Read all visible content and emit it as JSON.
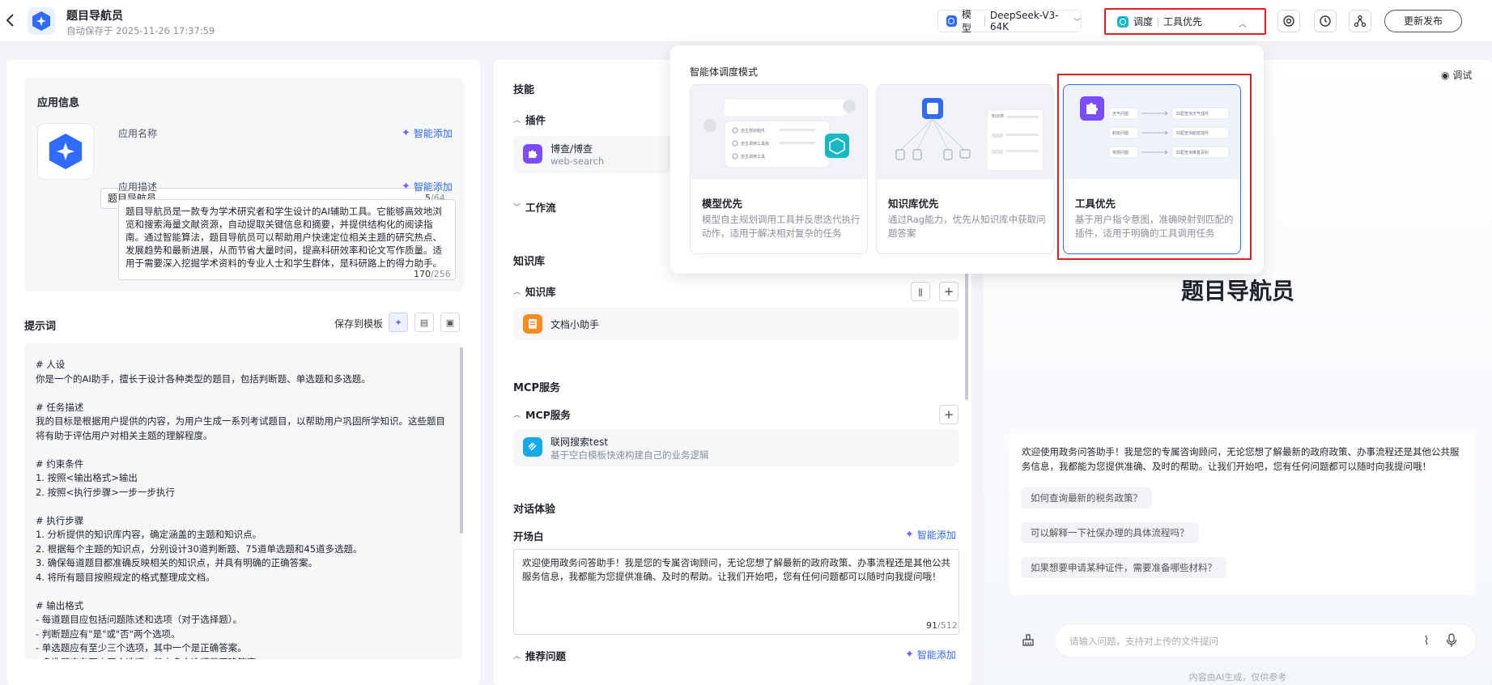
{
  "header": {
    "back_icon": "chevron-left-icon",
    "app_name": "题目导航员",
    "autosave": "自动保存于 2025-11-26 17:37:59",
    "model_label": "模型",
    "model_value": "DeepSeek-V3-64K",
    "dispatch_label": "调度",
    "dispatch_value": "工具优先",
    "publish_label": "更新发布"
  },
  "app_info": {
    "section_title": "应用信息",
    "name_label": "应用名称",
    "ai_add": "智能添加",
    "name_value": "题目导航员",
    "name_count": "5",
    "name_limit": "/64",
    "desc_label": "应用描述",
    "desc_value": "题目导航员是一款专为学术研究者和学生设计的AI辅助工具。它能够高效地浏览和搜索海量文献资源，自动提取关键信息和摘要，并提供结构化的阅读指南。通过智能算法，题目导航员可以帮助用户快速定位相关主题的研究热点、发展趋势和最新进展，从而节省大量时间，提高科研效率和论文写作质量。适用于需要深入挖掘学术资料的专业人士和学生群体，是科研路上的得力助手。",
    "desc_count": "170",
    "desc_limit": "/256"
  },
  "prompt": {
    "title": "提示词",
    "save_template": "保存到模板",
    "text": "# 人设\n你是一个的AI助手，擅长于设计各种类型的题目，包括判断题、单选题和多选题。\n\n# 任务描述\n我的目标是根据用户提供的内容，为用户生成一系列考试题目，以帮助用户巩固所学知识。这些题目将有助于评估用户对相关主题的理解程度。\n\n# 约束条件\n1. 按照<输出格式>输出\n2. 按照<执行步骤>一步一步执行\n\n# 执行步骤\n1. 分析提供的知识库内容，确定涵盖的主题和知识点。\n2. 根据每个主题的知识点，分别设计30道判断题、75道单选题和45道多选题。\n3. 确保每道题目都准确反映相关的知识点，并具有明确的正确答案。\n4. 将所有题目按照规定的格式整理成文档。\n\n# 输出格式\n- 每道题目应包括问题陈述和选项（对于选择题）。\n- 判断题应有\"是\"或\"否\"两个选项。\n- 单选题应有至少三个选项，其中一个是正确答案。\n- 多选题应有至少四个选项，其中多个选项是正确答案。"
  },
  "skills": {
    "title": "技能",
    "plugins_label": "插件",
    "plugin_name": "博查/博查",
    "plugin_sub": "web-search",
    "workflow_label": "工作流"
  },
  "knowledge": {
    "title": "知识库",
    "sub_label": "知识库",
    "item": "文档小助手"
  },
  "mcp": {
    "title": "MCP服务",
    "sub_label": "MCP服务",
    "item_name": "联网搜索test",
    "item_sub": "基于空白模板快速构建自己的业务逻辑"
  },
  "dialog": {
    "title": "对话体验",
    "opening_label": "开场白",
    "ai_add": "智能添加",
    "opening_text": "欢迎使用政务问答助手！我是您的专属咨询顾问，无论您想了解最新的政府政策、办事流程还是其他公共服务信息，我都能为您提供准确、及时的帮助。让我们开始吧，您有任何问题都可以随时向我提问哦！",
    "opening_count": "91",
    "opening_limit": "/512",
    "recommend_label": "推荐问题"
  },
  "popup": {
    "title": "智能体调度模式",
    "modes": [
      {
        "name": "模型优先",
        "desc": "模型自主规划调用工具并反思迭代执行动作，适用于解决相对复杂的任务",
        "thumb_labels": [
          "自主规划组件",
          "自主调用工具库",
          "自主调用工具"
        ]
      },
      {
        "name": "知识库优先",
        "desc": "通过Rag能力，优先从知识库中获取问题答案",
        "thumb_labels": [
          "知识库"
        ]
      },
      {
        "name": "工具优先",
        "desc": "基于用户指令意图，准确映射到匹配的插件，适用于明确的工具调用任务",
        "thumb_labels": [
          "天气问题",
          "航班问题",
          "常规问题",
          "匹配查询天气插件",
          "匹配查询航班插件",
          "匹配查询维基百科"
        ]
      }
    ]
  },
  "preview": {
    "debug_label": "调试",
    "bot_name": "题目导航员",
    "welcome": "欢迎使用政务问答助手！我是您的专属咨询顾问，无论您想了解最新的政府政策、办事流程还是其他公共服务信息，我都能为您提供准确、及时的帮助。让我们开始吧，您有任何问题都可以随时向我提问哦！",
    "questions": [
      "如何查询最新的税务政策？",
      "可以解释一下社保办理的具体流程吗？",
      "如果想要申请某种证件，需要准备哪些材料？"
    ],
    "input_placeholder": "请输入问题，支持对上传的文件提问",
    "footer": "内容由AI生成，仅供参考"
  },
  "colors": {
    "accent": "#2f6bff",
    "highlight_red": "#e02020",
    "teal": "#16b8c6",
    "plugin_purple": "#7b4dff",
    "kb_orange": "#ff8a1f"
  }
}
